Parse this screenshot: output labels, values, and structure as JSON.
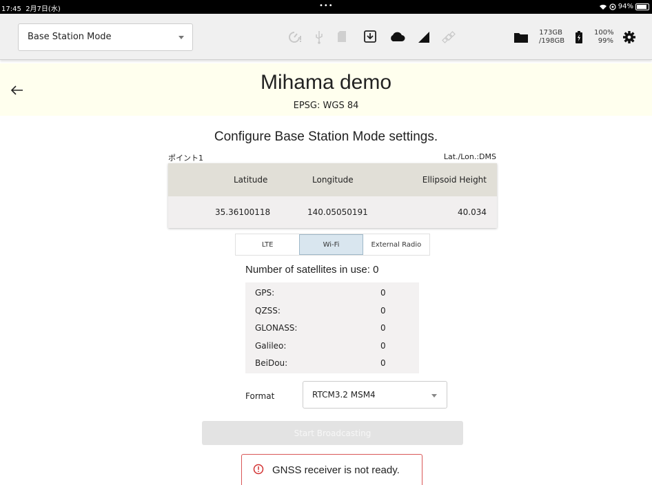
{
  "status_bar": {
    "time": "17:45",
    "date": "2月7日(水)",
    "dots": "•••",
    "wifi_icon": "wifi-icon",
    "battery": "94%"
  },
  "toolbar": {
    "mode_select": {
      "value": "Base Station Mode"
    },
    "icons": [
      "timer-alert-icon",
      "usb-icon",
      "sd-card-icon",
      "download-box-icon",
      "cloud-icon",
      "cellular-signal-icon",
      "satellite-icon",
      "folder-icon",
      "battery-charging-icon",
      "gear-icon"
    ],
    "storage": {
      "used": "173GB",
      "total": "/198GB"
    },
    "battery": {
      "line1": "100%",
      "line2": "99%"
    }
  },
  "header": {
    "title": "Mihama demo",
    "subtitle": "EPSG: WGS 84"
  },
  "config": {
    "heading": "Configure Base Station Mode settings.",
    "point_name": "ポイント1",
    "coord_format": "Lat./Lon.:DMS",
    "table": {
      "headers": [
        "Latitude",
        "Longitude",
        "Ellipsoid Height"
      ],
      "values": [
        "35.36100118",
        "140.05050191",
        "40.034"
      ]
    },
    "tabs": [
      {
        "label": "LTE",
        "active": false
      },
      {
        "label": "Wi-Fi",
        "active": true
      },
      {
        "label": "External Radio",
        "active": false
      }
    ],
    "satellites": {
      "summary": "Number of satellites in use: 0",
      "rows": [
        {
          "name": "GPS:",
          "count": "0"
        },
        {
          "name": "QZSS:",
          "count": "0"
        },
        {
          "name": "GLONASS:",
          "count": "0"
        },
        {
          "name": "Galileo:",
          "count": "0"
        },
        {
          "name": "BeiDou:",
          "count": "0"
        }
      ]
    },
    "format": {
      "label": "Format",
      "value": "RTCM3.2 MSM4"
    },
    "start_button": "Start Broadcasting",
    "error": "GNSS receiver is not ready."
  },
  "colors": {
    "header_band": "#ffffee",
    "table_header": "#e1dfd7",
    "active_tab": "#d9e6ef",
    "error_border": "#d95555"
  }
}
